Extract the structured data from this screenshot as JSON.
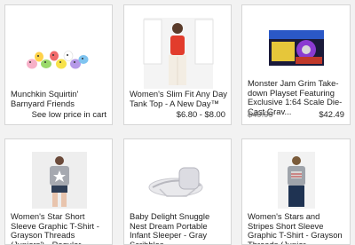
{
  "products": [
    {
      "title": "Munchkin Squirtin' Barnyard Friends",
      "price_note": "See low price in cart"
    },
    {
      "title": "Women's Slim Fit Any Day Tank Top - A New Day™",
      "price": "$6.80 - $8.00"
    },
    {
      "title": "Monster Jam Grim Take-down Playset  Featuring Exclusive 1:64 Scale Die-Cast Grav...",
      "original_price": "$49.99",
      "price": "$42.49"
    },
    {
      "title": "Women's Star Short Sleeve Graphic T-Shirt - Grayson Threads (Juniors') - Regular..."
    },
    {
      "title": "Baby Delight Snuggle Nest Dream Portable Infant Sleeper - Gray Scribbles"
    },
    {
      "title": "Women's Stars and Stripes Short Sleeve Graphic T-Shirt - Grayson Threads (Junior..."
    }
  ]
}
